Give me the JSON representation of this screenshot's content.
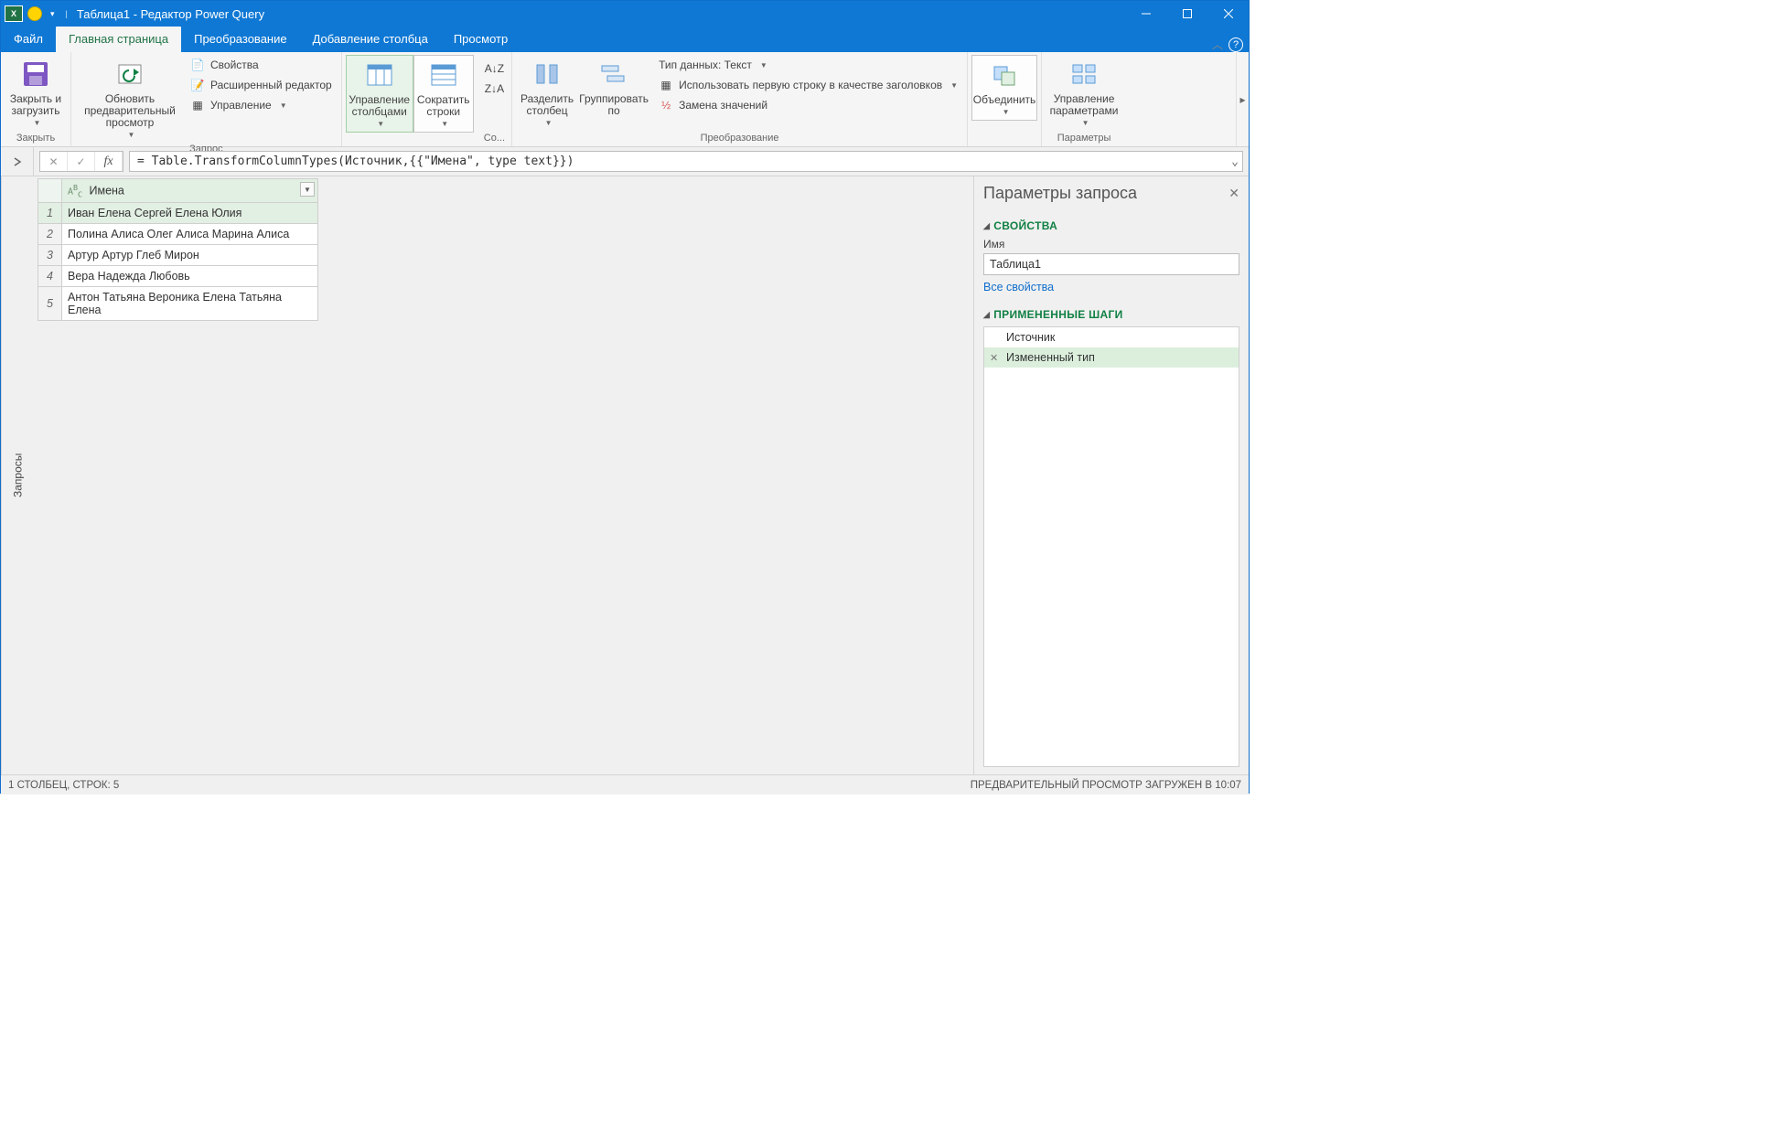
{
  "titlebar": {
    "title": "Таблица1 - Редактор Power Query"
  },
  "ribbon_tabs": {
    "file": "Файл",
    "home": "Главная страница",
    "transform": "Преобразование",
    "add_column": "Добавление столбца",
    "view": "Просмотр"
  },
  "ribbon": {
    "close_load": "Закрыть и загрузить",
    "group_close": "Закрыть",
    "refresh_preview": "Обновить предварительный просмотр",
    "properties": "Свойства",
    "advanced_editor": "Расширенный редактор",
    "manage": "Управление",
    "group_query": "Запрос",
    "manage_columns": "Управление столбцами",
    "reduce_rows": "Сократить строки",
    "group_sort": "Со...",
    "split_column": "Разделить столбец",
    "group_by": "Группировать по",
    "data_type_label": "Тип данных: Текст",
    "first_row_headers": "Использовать первую строку в качестве заголовков",
    "replace_values": "Замена значений",
    "group_transform": "Преобразование",
    "combine": "Объединить",
    "manage_params": "Управление параметрами",
    "group_params": "Параметры"
  },
  "formula": {
    "text": "= Table.TransformColumnTypes(Источник,{{\"Имена\", type text}})"
  },
  "queries_sidebar": "Запросы",
  "table": {
    "column_header": "Имена",
    "rows": [
      "Иван Елена Сергей Елена Юлия",
      "Полина Алиса Олег Алиса Марина Алиса",
      "Артур Артур Глеб Мирон",
      "Вера Надежда Любовь",
      "Антон Татьяна Вероника Елена Татьяна Елена"
    ]
  },
  "settings": {
    "pane_title": "Параметры запроса",
    "section_props": "СВОЙСТВА",
    "name_label": "Имя",
    "name_value": "Таблица1",
    "all_props_link": "Все свойства",
    "section_steps": "ПРИМЕНЕННЫЕ ШАГИ",
    "steps": [
      "Источник",
      "Измененный тип"
    ]
  },
  "statusbar": {
    "left": "1 СТОЛБЕЦ, СТРОК: 5",
    "right": "ПРЕДВАРИТЕЛЬНЫЙ ПРОСМОТР ЗАГРУЖЕН В 10:07"
  }
}
